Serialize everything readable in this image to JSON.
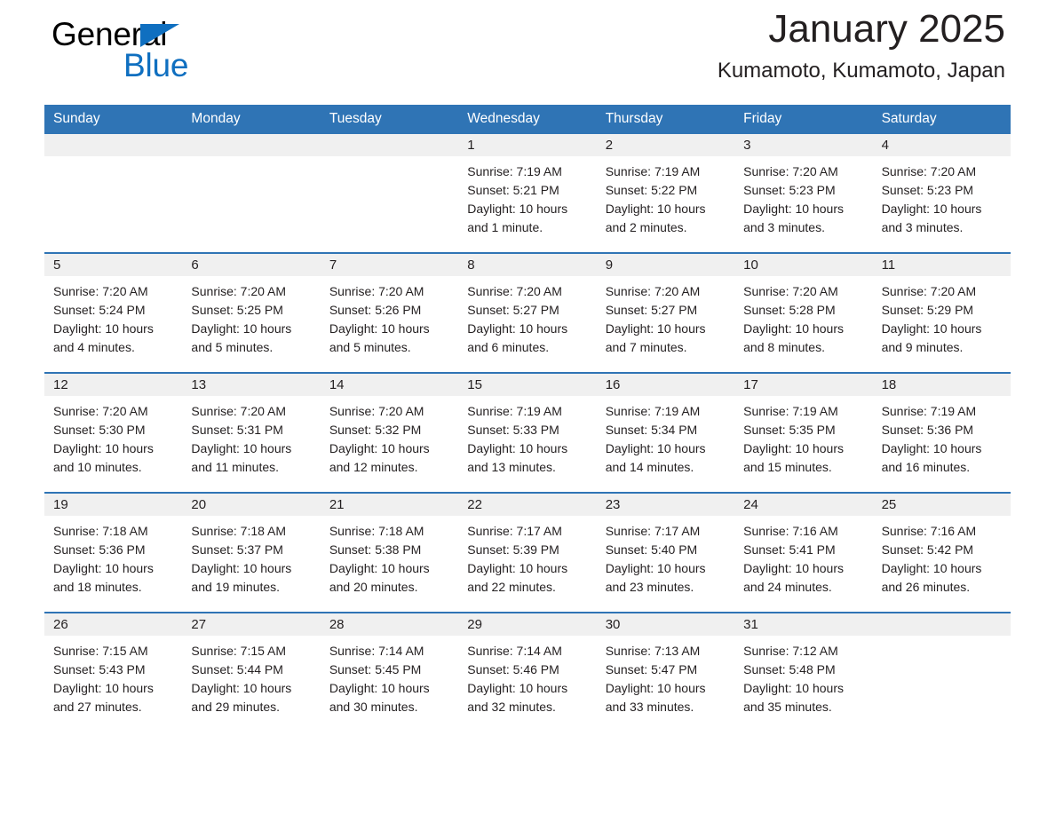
{
  "brand": {
    "name_part1": "General",
    "name_part2": "Blue",
    "triangle_icon": "brand-triangle-icon",
    "accent_color": "#0f6fc0"
  },
  "header": {
    "title": "January 2025",
    "subtitle": "Kumamoto, Kumamoto, Japan"
  },
  "theme": {
    "header_blue": "#2f74b5",
    "day_band_gray": "#f0f0f0",
    "text_color": "#231f20"
  },
  "weekdays": [
    "Sunday",
    "Monday",
    "Tuesday",
    "Wednesday",
    "Thursday",
    "Friday",
    "Saturday"
  ],
  "weeks": [
    [
      {
        "day": "",
        "empty": true
      },
      {
        "day": "",
        "empty": true
      },
      {
        "day": "",
        "empty": true
      },
      {
        "day": "1",
        "sunrise": "Sunrise: 7:19 AM",
        "sunset": "Sunset: 5:21 PM",
        "daylight_line1": "Daylight: 10 hours",
        "daylight_line2": "and 1 minute."
      },
      {
        "day": "2",
        "sunrise": "Sunrise: 7:19 AM",
        "sunset": "Sunset: 5:22 PM",
        "daylight_line1": "Daylight: 10 hours",
        "daylight_line2": "and 2 minutes."
      },
      {
        "day": "3",
        "sunrise": "Sunrise: 7:20 AM",
        "sunset": "Sunset: 5:23 PM",
        "daylight_line1": "Daylight: 10 hours",
        "daylight_line2": "and 3 minutes."
      },
      {
        "day": "4",
        "sunrise": "Sunrise: 7:20 AM",
        "sunset": "Sunset: 5:23 PM",
        "daylight_line1": "Daylight: 10 hours",
        "daylight_line2": "and 3 minutes."
      }
    ],
    [
      {
        "day": "5",
        "sunrise": "Sunrise: 7:20 AM",
        "sunset": "Sunset: 5:24 PM",
        "daylight_line1": "Daylight: 10 hours",
        "daylight_line2": "and 4 minutes."
      },
      {
        "day": "6",
        "sunrise": "Sunrise: 7:20 AM",
        "sunset": "Sunset: 5:25 PM",
        "daylight_line1": "Daylight: 10 hours",
        "daylight_line2": "and 5 minutes."
      },
      {
        "day": "7",
        "sunrise": "Sunrise: 7:20 AM",
        "sunset": "Sunset: 5:26 PM",
        "daylight_line1": "Daylight: 10 hours",
        "daylight_line2": "and 5 minutes."
      },
      {
        "day": "8",
        "sunrise": "Sunrise: 7:20 AM",
        "sunset": "Sunset: 5:27 PM",
        "daylight_line1": "Daylight: 10 hours",
        "daylight_line2": "and 6 minutes."
      },
      {
        "day": "9",
        "sunrise": "Sunrise: 7:20 AM",
        "sunset": "Sunset: 5:27 PM",
        "daylight_line1": "Daylight: 10 hours",
        "daylight_line2": "and 7 minutes."
      },
      {
        "day": "10",
        "sunrise": "Sunrise: 7:20 AM",
        "sunset": "Sunset: 5:28 PM",
        "daylight_line1": "Daylight: 10 hours",
        "daylight_line2": "and 8 minutes."
      },
      {
        "day": "11",
        "sunrise": "Sunrise: 7:20 AM",
        "sunset": "Sunset: 5:29 PM",
        "daylight_line1": "Daylight: 10 hours",
        "daylight_line2": "and 9 minutes."
      }
    ],
    [
      {
        "day": "12",
        "sunrise": "Sunrise: 7:20 AM",
        "sunset": "Sunset: 5:30 PM",
        "daylight_line1": "Daylight: 10 hours",
        "daylight_line2": "and 10 minutes."
      },
      {
        "day": "13",
        "sunrise": "Sunrise: 7:20 AM",
        "sunset": "Sunset: 5:31 PM",
        "daylight_line1": "Daylight: 10 hours",
        "daylight_line2": "and 11 minutes."
      },
      {
        "day": "14",
        "sunrise": "Sunrise: 7:20 AM",
        "sunset": "Sunset: 5:32 PM",
        "daylight_line1": "Daylight: 10 hours",
        "daylight_line2": "and 12 minutes."
      },
      {
        "day": "15",
        "sunrise": "Sunrise: 7:19 AM",
        "sunset": "Sunset: 5:33 PM",
        "daylight_line1": "Daylight: 10 hours",
        "daylight_line2": "and 13 minutes."
      },
      {
        "day": "16",
        "sunrise": "Sunrise: 7:19 AM",
        "sunset": "Sunset: 5:34 PM",
        "daylight_line1": "Daylight: 10 hours",
        "daylight_line2": "and 14 minutes."
      },
      {
        "day": "17",
        "sunrise": "Sunrise: 7:19 AM",
        "sunset": "Sunset: 5:35 PM",
        "daylight_line1": "Daylight: 10 hours",
        "daylight_line2": "and 15 minutes."
      },
      {
        "day": "18",
        "sunrise": "Sunrise: 7:19 AM",
        "sunset": "Sunset: 5:36 PM",
        "daylight_line1": "Daylight: 10 hours",
        "daylight_line2": "and 16 minutes."
      }
    ],
    [
      {
        "day": "19",
        "sunrise": "Sunrise: 7:18 AM",
        "sunset": "Sunset: 5:36 PM",
        "daylight_line1": "Daylight: 10 hours",
        "daylight_line2": "and 18 minutes."
      },
      {
        "day": "20",
        "sunrise": "Sunrise: 7:18 AM",
        "sunset": "Sunset: 5:37 PM",
        "daylight_line1": "Daylight: 10 hours",
        "daylight_line2": "and 19 minutes."
      },
      {
        "day": "21",
        "sunrise": "Sunrise: 7:18 AM",
        "sunset": "Sunset: 5:38 PM",
        "daylight_line1": "Daylight: 10 hours",
        "daylight_line2": "and 20 minutes."
      },
      {
        "day": "22",
        "sunrise": "Sunrise: 7:17 AM",
        "sunset": "Sunset: 5:39 PM",
        "daylight_line1": "Daylight: 10 hours",
        "daylight_line2": "and 22 minutes."
      },
      {
        "day": "23",
        "sunrise": "Sunrise: 7:17 AM",
        "sunset": "Sunset: 5:40 PM",
        "daylight_line1": "Daylight: 10 hours",
        "daylight_line2": "and 23 minutes."
      },
      {
        "day": "24",
        "sunrise": "Sunrise: 7:16 AM",
        "sunset": "Sunset: 5:41 PM",
        "daylight_line1": "Daylight: 10 hours",
        "daylight_line2": "and 24 minutes."
      },
      {
        "day": "25",
        "sunrise": "Sunrise: 7:16 AM",
        "sunset": "Sunset: 5:42 PM",
        "daylight_line1": "Daylight: 10 hours",
        "daylight_line2": "and 26 minutes."
      }
    ],
    [
      {
        "day": "26",
        "sunrise": "Sunrise: 7:15 AM",
        "sunset": "Sunset: 5:43 PM",
        "daylight_line1": "Daylight: 10 hours",
        "daylight_line2": "and 27 minutes."
      },
      {
        "day": "27",
        "sunrise": "Sunrise: 7:15 AM",
        "sunset": "Sunset: 5:44 PM",
        "daylight_line1": "Daylight: 10 hours",
        "daylight_line2": "and 29 minutes."
      },
      {
        "day": "28",
        "sunrise": "Sunrise: 7:14 AM",
        "sunset": "Sunset: 5:45 PM",
        "daylight_line1": "Daylight: 10 hours",
        "daylight_line2": "and 30 minutes."
      },
      {
        "day": "29",
        "sunrise": "Sunrise: 7:14 AM",
        "sunset": "Sunset: 5:46 PM",
        "daylight_line1": "Daylight: 10 hours",
        "daylight_line2": "and 32 minutes."
      },
      {
        "day": "30",
        "sunrise": "Sunrise: 7:13 AM",
        "sunset": "Sunset: 5:47 PM",
        "daylight_line1": "Daylight: 10 hours",
        "daylight_line2": "and 33 minutes."
      },
      {
        "day": "31",
        "sunrise": "Sunrise: 7:12 AM",
        "sunset": "Sunset: 5:48 PM",
        "daylight_line1": "Daylight: 10 hours",
        "daylight_line2": "and 35 minutes."
      },
      {
        "day": "",
        "empty": true
      }
    ]
  ]
}
